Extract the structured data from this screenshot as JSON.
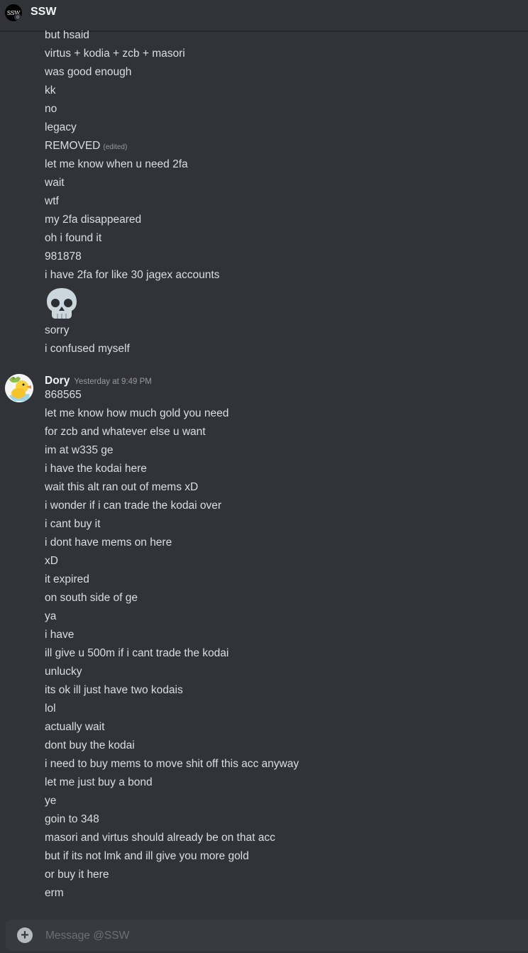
{
  "header": {
    "title": "SSW",
    "avatar_text": "SSW"
  },
  "messages": {
    "group1_lines": [
      "but hsaid",
      "virtus + kodia + zcb + masori",
      "was good enough",
      "kk",
      "no",
      "legacy",
      "REMOVED",
      "let me know when u need 2fa",
      "wait",
      "wtf",
      "my 2fa disappeared",
      "oh i found it",
      "981878",
      "i have 2fa for like 30 jagex accounts",
      "sorry",
      "i confused myself"
    ],
    "edited_label": "(edited)",
    "skull_emoji": "skull-icon",
    "group2": {
      "author": "Dory",
      "timestamp": "Yesterday at 9:49 PM",
      "lines": [
        "868565",
        "let me know how much gold you need",
        "for zcb and whatever else u want",
        "im at w335 ge",
        "i have the kodai here",
        "wait this alt ran out of mems xD",
        "i wonder if i can trade the kodai over",
        "i cant buy it",
        "i dont have mems on here",
        "xD",
        "it expired",
        "on south side of ge",
        "ya",
        "i have",
        "ill give u 500m if i cant trade the kodai",
        "unlucky",
        "its ok ill just have two kodais",
        "lol",
        "actually wait",
        "dont buy the kodai",
        "i need to buy mems to move shit off this acc anyway",
        "let me just buy a bond",
        "ye",
        "goin to 348",
        "masori and virtus should already be on that acc",
        "but if its not lmk and ill give you more gold",
        "or buy it here",
        "erm"
      ]
    }
  },
  "composer": {
    "placeholder": "Message @SSW"
  },
  "colors": {
    "background": "#313338",
    "text": "#dbdee1",
    "muted": "#949ba4",
    "composer": "#383a40"
  }
}
